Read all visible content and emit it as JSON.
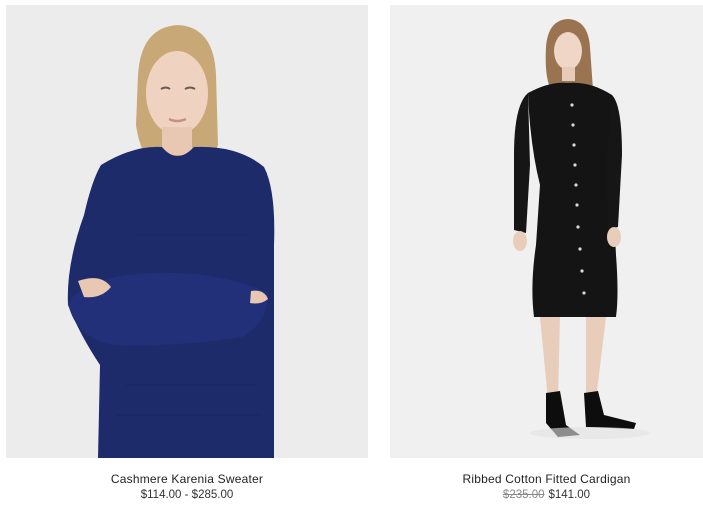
{
  "products": [
    {
      "name": "Cashmere Karenia Sweater",
      "price": "$114.00 - $285.00",
      "image_alt": "Model wearing navy cashmere sweater"
    },
    {
      "name": "Ribbed Cotton Fitted Cardigan",
      "original_price": "$235.00",
      "sale_price": "$141.00",
      "image_alt": "Model wearing black ribbed knee-length cardigan dress"
    }
  ],
  "colors": {
    "navy": "#1e2b6b",
    "black": "#141414",
    "background": "#ececec",
    "strike": "#8a8a8a"
  }
}
